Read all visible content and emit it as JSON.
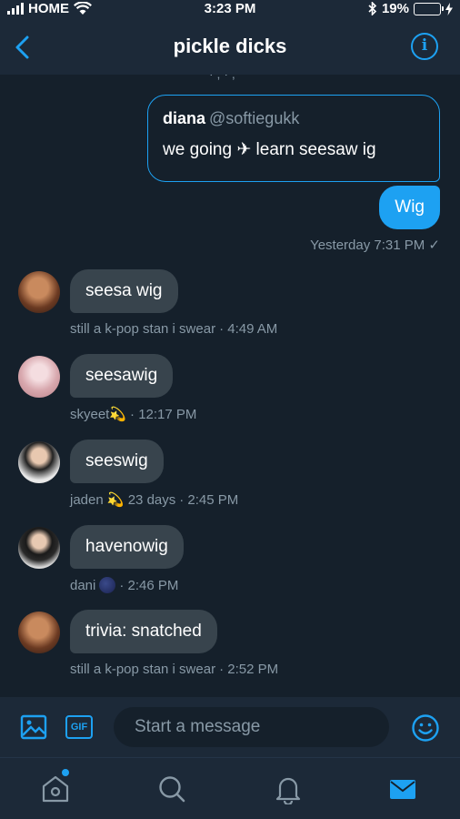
{
  "status_bar": {
    "carrier": "HOME",
    "time": "3:23 PM",
    "battery": "19%",
    "battery_level": 0.19
  },
  "header": {
    "title": "pickle dicks",
    "back_icon": "chevron-left-icon",
    "info_icon": "info-icon"
  },
  "conversation": {
    "clipped_text": "· ; · ,",
    "quoted_tweet": {
      "name": "diana",
      "handle": "@softiegukk",
      "text": "we going ✈ learn seesaw ig"
    },
    "own_message": {
      "text": "Wig",
      "meta": "Yesterday 7:31 PM ✓"
    },
    "messages": [
      {
        "text": "seesa wig",
        "sender": "still a k-pop stan i swear",
        "emoji": "",
        "time": "· 4:49 AM"
      },
      {
        "text": "seesawig",
        "sender": "skyeet💫",
        "emoji": "",
        "time": "· 12:17 PM"
      },
      {
        "text": "seeswig",
        "sender": "jaden 💫 23 days",
        "emoji": "",
        "time": "· 2:45 PM"
      },
      {
        "text": "havenowig",
        "sender": "dani",
        "emoji": "🌑",
        "time": "· 2:46 PM"
      },
      {
        "text": "trivia: snatched",
        "sender": "still a k-pop stan i swear",
        "emoji": "",
        "time": "· 2:52 PM"
      }
    ]
  },
  "composer": {
    "placeholder": "Start a message",
    "gif_label": "GIF"
  },
  "colors": {
    "background": "#15202b",
    "header": "#1c2938",
    "accent": "#1da1f2",
    "bubble": "#38444d",
    "muted": "#8899a6"
  }
}
